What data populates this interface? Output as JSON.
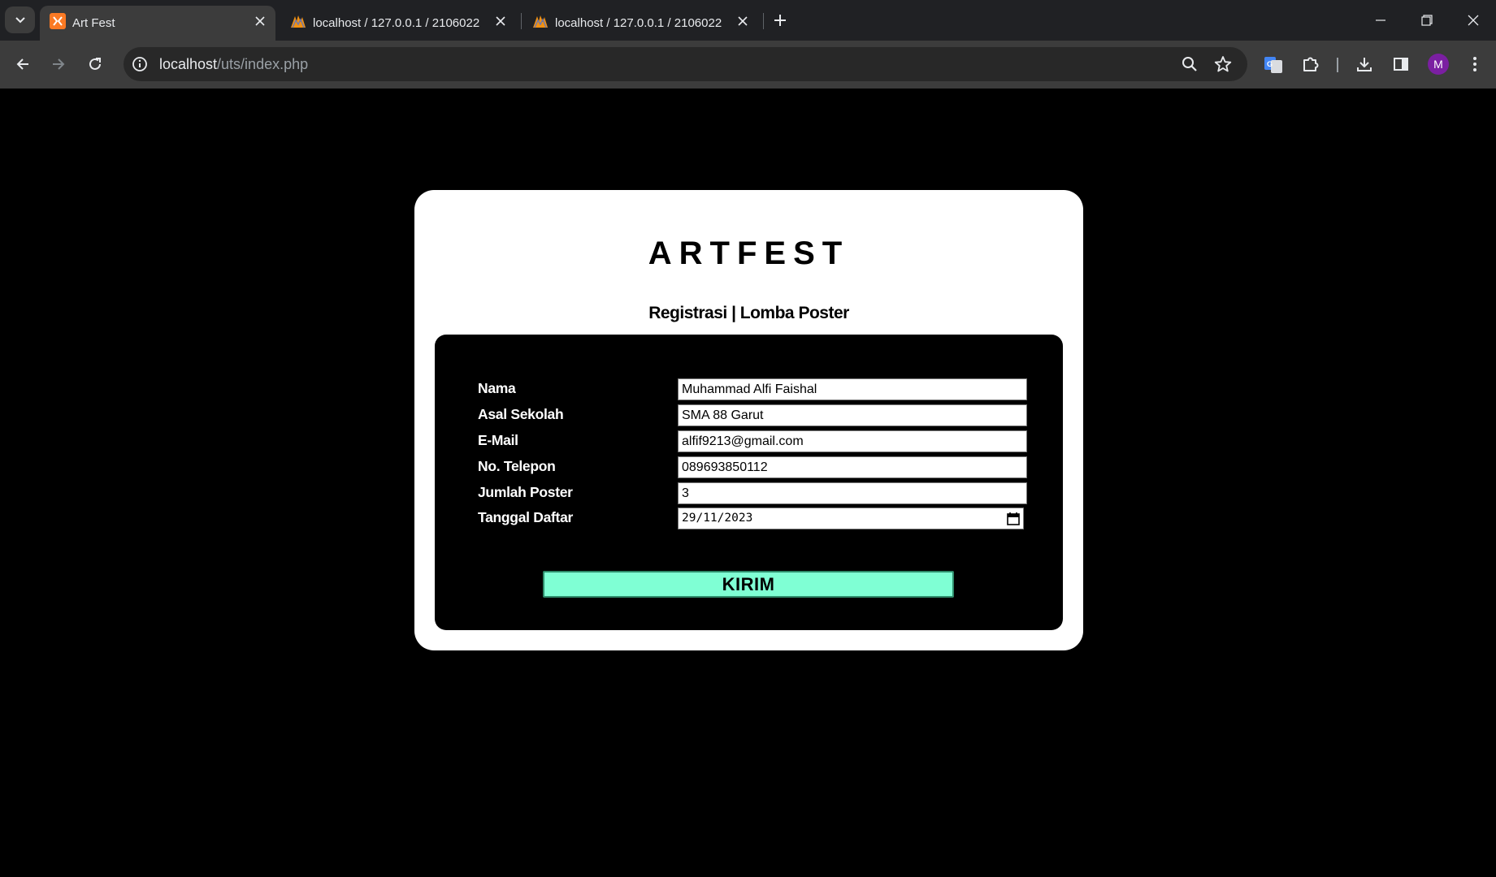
{
  "browser": {
    "tabs": [
      {
        "title": "Art Fest",
        "active": true,
        "favicon": "xampp-icon"
      },
      {
        "title": "localhost / 127.0.0.1 / 2106022",
        "active": false,
        "favicon": "phpmyadmin-icon"
      },
      {
        "title": "localhost / 127.0.0.1 / 2106022",
        "active": false,
        "favicon": "phpmyadmin-icon"
      }
    ],
    "url_host": "localhost",
    "url_path": "/uts/index.php",
    "profile_initial": "M",
    "colors": {
      "tabbar": "#202124",
      "toolbar": "#3c3c3c",
      "avatar": "#7b1fa2"
    }
  },
  "page": {
    "brand": "ARTFEST",
    "subtitle": "Registrasi | Lomba Poster",
    "form": {
      "fields": [
        {
          "label": "Nama",
          "value": "Muhammad Alfi Faishal"
        },
        {
          "label": "Asal Sekolah",
          "value": "SMA 88 Garut"
        },
        {
          "label": "E-Mail",
          "value": "alfif9213@gmail.com"
        },
        {
          "label": "No. Telepon",
          "value": "089693850112"
        },
        {
          "label": "Jumlah Poster",
          "value": "3"
        },
        {
          "label": "Tanggal Daftar",
          "value": "29/11/2023"
        }
      ],
      "submit_label": "KIRIM"
    },
    "colors": {
      "background": "#000000",
      "card": "#ffffff",
      "submit": "#7fffd4"
    }
  }
}
